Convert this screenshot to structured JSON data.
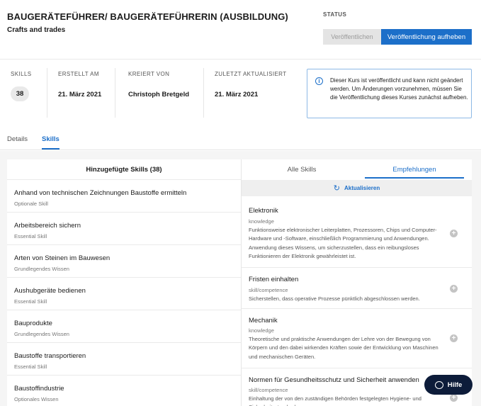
{
  "course": {
    "title": "BAUGERÄTEFÜHRER/ BAUGERÄTEFÜHRERIN (AUSBILDUNG)",
    "subtitle": "Crafts and trades"
  },
  "status": {
    "label": "STATUS",
    "publish_label": "Veröffentlichen",
    "unpublish_label": "Veröffentlichung aufheben"
  },
  "meta": {
    "skills_label": "SKILLS",
    "skills_value": "38",
    "created_label": "ERSTELLT AM",
    "created_value": "21. März 2021",
    "creator_label": "KREIERT VON",
    "creator_value": "Christoph Bretgeld",
    "updated_label": "ZULETZT AKTUALISIERT",
    "updated_value": "21. März 2021"
  },
  "info": {
    "icon": "info-icon",
    "glyph": "i",
    "text": "Dieser Kurs ist veröffentlicht und kann nicht geändert werden. Um Änderungen vorzunehmen, müssen Sie die Veröffentlichung dieses Kurses zunächst aufheben."
  },
  "tabs": [
    {
      "label": "Details",
      "active": false
    },
    {
      "label": "Skills",
      "active": true
    }
  ],
  "added": {
    "heading": "Hinzugefügte Skills (38)",
    "items": [
      {
        "name": "Anhand von technischen Zeichnungen Baustoffe ermitteln",
        "type": "Optionale Skill"
      },
      {
        "name": "Arbeitsbereich sichern",
        "type": "Essential Skill"
      },
      {
        "name": "Arten von Steinen im Bauwesen",
        "type": "Grundlegendes Wissen"
      },
      {
        "name": "Aushubgeräte bedienen",
        "type": "Essential Skill"
      },
      {
        "name": "Bauprodukte",
        "type": "Grundlegendes Wissen"
      },
      {
        "name": "Baustoffe transportieren",
        "type": "Essential Skill"
      },
      {
        "name": "Baustoffindustrie",
        "type": "Optionales Wissen"
      }
    ]
  },
  "right_tabs": {
    "all_label": "Alle Skills",
    "rec_label": "Empfehlungen"
  },
  "refresh": {
    "icon": "refresh-icon",
    "glyph": "↻",
    "label": "Aktualisieren"
  },
  "recommendations": [
    {
      "title": "Elektronik",
      "kind": "knowledge",
      "desc": "Funktionsweise elektronischer Leiterplatten, Prozessoren, Chips und Computer-Hardware und -Software, einschließlich Programmierung und Anwendungen. Anwendung dieses Wissens, um sicherzustellen, dass ein reibungsloses Funktionieren der Elektronik gewährleistet ist."
    },
    {
      "title": "Fristen einhalten",
      "kind": "skill/competence",
      "desc": "Sicherstellen, dass operative Prozesse pünktlich abgeschlossen werden."
    },
    {
      "title": "Mechanik",
      "kind": "knowledge",
      "desc": "Theoretische und praktische Anwendungen der Lehre von der Bewegung von Körpern und den dabei wirkenden Kräften sowie der Entwicklung von Maschinen und mechanischen Geräten."
    },
    {
      "title": "Normen für Gesundheitsschutz und Sicherheit anwenden",
      "kind": "skill/competence",
      "desc": "Einhaltung der von den zuständigen Behörden festgelegten Hygiene- und Sicherheitsstandards."
    }
  ],
  "help": {
    "label": "Hilfe",
    "icon": "chat-bubble-icon"
  }
}
